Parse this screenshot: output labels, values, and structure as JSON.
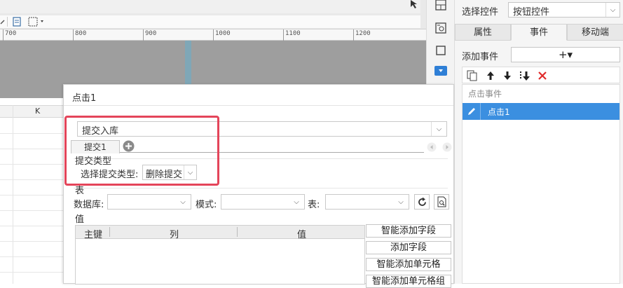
{
  "ruler": {
    "ticks": [
      "700",
      "800",
      "900",
      "1000",
      "1100",
      "1200"
    ]
  },
  "sheet": {
    "column_label": "K"
  },
  "properties_panel": {
    "select_control_label": "选择控件",
    "select_control_value": "按钮控件",
    "tabs": [
      {
        "label": "属性",
        "active": false
      },
      {
        "label": "事件",
        "active": true
      },
      {
        "label": "移动端",
        "active": false
      }
    ],
    "add_event_label": "添加事件",
    "add_event_button": "+▾",
    "event_category": "点击事件",
    "events": [
      {
        "label": "点击1",
        "selected": true
      }
    ]
  },
  "dialog": {
    "title": "点击1",
    "action_select_value": "提交入库",
    "submit_tab_label": "提交1",
    "submit_type_section": "提交类型",
    "submit_type_label": "选择提交类型:",
    "submit_type_value": "删除提交",
    "table_section": "表",
    "database_label": "数据库:",
    "database_value": "",
    "schema_label": "模式:",
    "schema_value": "",
    "table_label": "表:",
    "table_value": "",
    "value_section": "值",
    "columns": [
      "主键",
      "列",
      "值"
    ],
    "buttons": {
      "smart_add_field": "智能添加字段",
      "add_field": "添加字段",
      "smart_add_cell": "智能添加单元格",
      "smart_add_cell_group": "智能添加单元格组"
    }
  },
  "colors": {
    "highlight": "#e4455a",
    "selected_event_bg": "#3b8fe0",
    "delete_icon": "#e02b2b"
  }
}
